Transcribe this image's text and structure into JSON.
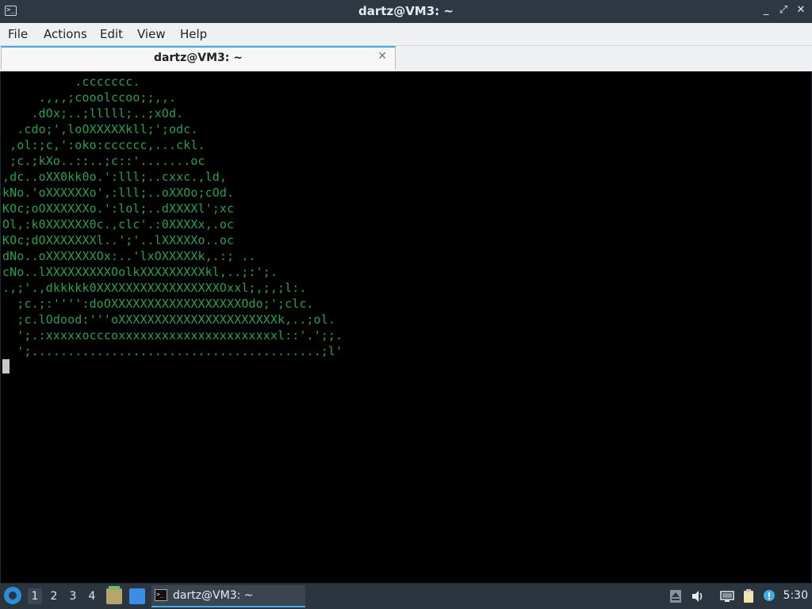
{
  "window": {
    "title": "dartz@VM3: ~",
    "controls": [
      "_",
      "⤢",
      "✕"
    ]
  },
  "menu": [
    "File",
    "Actions",
    "Edit",
    "View",
    "Help"
  ],
  "tab": {
    "label": "dartz@VM3: ~",
    "close": "✕"
  },
  "terminal": {
    "lines": [
      "          .ccccccc.",
      "     .,,,;cooolccoo;;,,.",
      "    .dOx;..;lllll;..;xOd.",
      "  .cdo;',loOXXXXXkll;';odc.",
      " ,ol:;c,':oko:cccccc,...ckl.",
      " ;c.;kXo..::..;c::'.......oc",
      ",dc..oXX0kk0o.':lll;..cxxc.,ld,",
      "kNo.'oXXXXXXo',:lll;..oXXOo;cOd.",
      "KOc;oOXXXXXXo.':lol;..dXXXXl';xc",
      "Ol,:k0XXXXXX0c.,clc'.:0XXXXx,.oc",
      "KOc;dOXXXXXXXl..';'..lXXXXXo..oc",
      "dNo..oXXXXXXXOx:..'lxOXXXXXk,.:; ..",
      "cNo..lXXXXXXXXXOolkXXXXXXXXXkl,..;:';.",
      ".,;'.,dkkkkk0XXXXXXXXXXXXXXXXXOxxl;,;,;l:.",
      "  ;c.;:'''':doOXXXXXXXXXXXXXXXXXXOdo;';clc.",
      "  ;c.lOdood:'''oXXXXXXXXXXXXXXXXXXXXXXk,..;ol.",
      "  ';.:xxxxxocccoxxxxxxxxxxxxxxxxxxxxxxl::'.';;.",
      "  ';........................................;l'"
    ]
  },
  "taskbar": {
    "workspaces": [
      "1",
      "2",
      "3",
      "4"
    ],
    "active_workspace": "1",
    "task_label": "dartz@VM3: ~",
    "clock": "5:30"
  }
}
